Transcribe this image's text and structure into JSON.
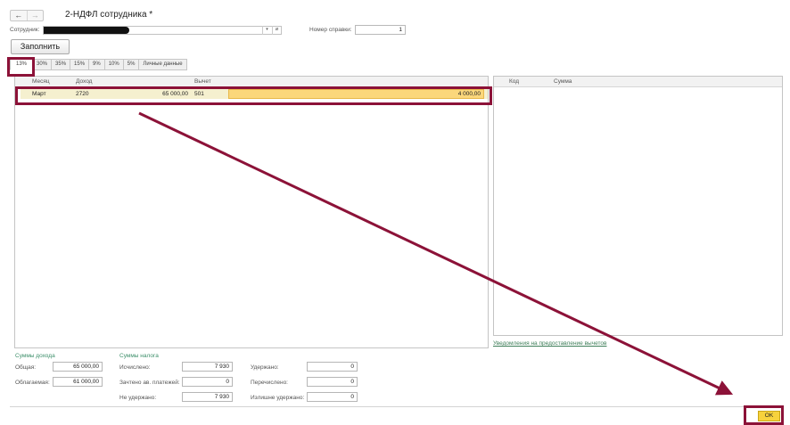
{
  "header": {
    "back_label": "←",
    "forward_label": "→",
    "title": "2-НДФЛ сотрудника *"
  },
  "form": {
    "employee_label": "Сотрудник:",
    "employee_value": "",
    "cert_number_label": "Номер справки:",
    "cert_number_value": "1",
    "fill_button": "Заполнить"
  },
  "tabs": [
    "13%",
    "30%",
    "35%",
    "15%",
    "9%",
    "10%",
    "5%",
    "Личные данные"
  ],
  "income_table": {
    "columns": [
      "Месяц",
      "Доход",
      "Вычет"
    ],
    "rows": [
      {
        "month": "Март",
        "income_code": "2720",
        "income_amount": "65 000,00",
        "deduction_code": "501",
        "deduction_amount": "4 000,00"
      }
    ]
  },
  "deduction_table": {
    "columns": [
      "Код",
      "Сумма"
    ]
  },
  "notices_link": "Уведомления на предоставление вычетов",
  "income_sums": {
    "title": "Суммы дохода",
    "total_label": "Общая:",
    "total_value": "65 000,00",
    "taxable_label": "Облагаемая:",
    "taxable_value": "61 000,00"
  },
  "tax_sums": {
    "title": "Суммы налога",
    "calculated_label": "Исчислено:",
    "calculated_value": "7 930",
    "advance_label": "Зачтено ав. платежей:",
    "advance_value": "0",
    "not_withheld_label": "Не удержано:",
    "not_withheld_value": "7 930",
    "withheld_label": "Удержано:",
    "withheld_value": "0",
    "transferred_label": "Перечислено:",
    "transferred_value": "0",
    "excess_label": "Излишне удержано:",
    "excess_value": "0"
  },
  "footer": {
    "ok_button": "OK"
  },
  "colors": {
    "accent_red": "#8c1238",
    "ok_yellow": "#f7d23c",
    "section_green": "#3d8f6a",
    "row_highlight": "#fbd77b"
  }
}
